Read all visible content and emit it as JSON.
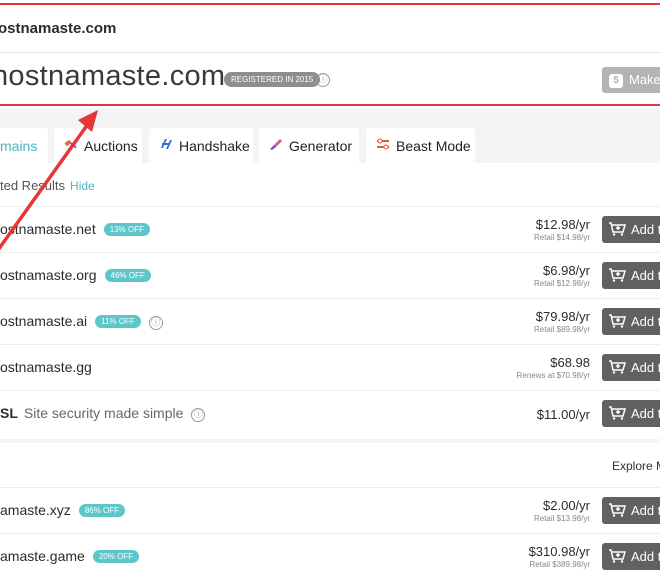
{
  "header": {
    "breadcrumb": "ostnamaste.com",
    "title": "hostnamaste.com",
    "registered_badge": "REGISTERED IN 2015",
    "info_icon": "ⓘ",
    "offer_button": "Make",
    "offer_icon": "$"
  },
  "tabs": [
    {
      "label": "mains",
      "icon": "",
      "active": true
    },
    {
      "label": "Auctions",
      "icon": "auction-icon"
    },
    {
      "label": "Handshake",
      "icon": "handshake-icon"
    },
    {
      "label": "Generator",
      "icon": "generator-icon"
    },
    {
      "label": "Beast Mode",
      "icon": "beast-mode-icon"
    }
  ],
  "results": {
    "heading": "ted Results",
    "hide_label": "Hide",
    "rows": [
      {
        "name": "ostnamaste.net",
        "badge": "13% OFF",
        "price": "$12.98/yr",
        "sub": "Retail $14.98/yr",
        "button": "Add t"
      },
      {
        "name": "ostnamaste.org",
        "badge": "46% OFF",
        "price": "$6.98/yr",
        "sub": "Retail $12.98/yr",
        "button": "Add t"
      },
      {
        "name": "ostnamaste.ai",
        "badge": "11% OFF",
        "price": "$79.98/yr",
        "sub": "Retail $89.98/yr",
        "button": "Add t"
      },
      {
        "name": "ostnamaste.gg",
        "badge": "",
        "price": "$68.98",
        "sub": "Renews at $70.98/yr",
        "button": "Add t"
      },
      {
        "name": "SL",
        "desc": "Site security made simple",
        "price": "$11.00/yr",
        "sub": "",
        "button": "Add t"
      }
    ]
  },
  "lower": {
    "explore_label": "Explore M",
    "rows": [
      {
        "name": "amaste.xyz",
        "badge": "86% OFF",
        "price": "$2.00/yr",
        "sub": "Retail $13.98/yr",
        "button": "Add t"
      },
      {
        "name": "amaste.game",
        "badge": "20% OFF",
        "price": "$310.98/yr",
        "sub": "Retail $389.98/yr",
        "button": "Add t"
      }
    ]
  },
  "colors": {
    "accent": "#4bb6c2",
    "badge": "#5cc6c9",
    "annotation": "#e53535",
    "button_dark": "#616161"
  }
}
